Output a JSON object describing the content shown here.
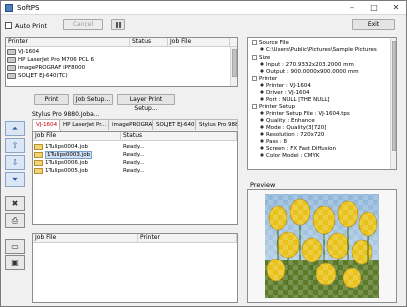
{
  "window": {
    "title": "SoftPS"
  },
  "toolbar": {
    "auto_print_label": "Auto Print",
    "cancel_label": "Cancel",
    "exit_label": "Exit"
  },
  "printers": {
    "headers": [
      "Printer",
      "Status",
      "Job File"
    ],
    "rows": [
      {
        "name": "VJ-1604",
        "status": "",
        "job": ""
      },
      {
        "name": "HP LaserJet Pro M706 PCL 6",
        "status": "",
        "job": ""
      },
      {
        "name": "imagePROGRAF iPF8000",
        "status": "",
        "job": ""
      },
      {
        "name": "SOLJET EJ-640(TC)",
        "status": "",
        "job": ""
      }
    ]
  },
  "actions": {
    "print": "Print",
    "job_setup": "Job Setup...",
    "layer_print_setup": "Layer Print Setup..."
  },
  "queue_title": "Stylus Pro 9880.Joba...",
  "tabs": [
    "VJ-1604",
    "HP LaserJet Pr...",
    "imagePROGRA...",
    "SOLJET EJ-640...",
    "Stylus Pro 9880..."
  ],
  "jobs": {
    "headers": [
      "Job File",
      "Status"
    ],
    "rows": [
      {
        "file": "1Tulips0004.job",
        "status": "Ready..."
      },
      {
        "file": "1Tulips0003.job",
        "status": "Ready..."
      },
      {
        "file": "1Tulips0006.job",
        "status": "Ready..."
      },
      {
        "file": "1Tulips0005.job",
        "status": "Ready..."
      }
    ]
  },
  "history": {
    "headers": [
      "Job File",
      "Printer"
    ]
  },
  "details": {
    "source_file_label": "Source File",
    "source_file_value": "C:\\Users\\Public\\Pictures\\Sample Pictures",
    "size_label": "Size",
    "size_input": "Input : 270.9332x203.2000 mm",
    "size_output": "Output : 900.0000x900.0000 mm",
    "printer_label": "Printer",
    "printer_name": "Printer : VJ-1604",
    "printer_driver": "Driver : VJ-1604",
    "printer_port": "Port : NULL [THE NULL]",
    "setup_label": "Printer Setup",
    "setup_file": "Printer Setup File : VJ-1604.tps",
    "setup_quality": "Quality : Enhance",
    "setup_mode": "Mode : Quality(3[720]",
    "setup_resolution": "Resolution : 720x720",
    "setup_pass": "Pass : 8",
    "setup_screen": "Screen : FX Fast Diffusion",
    "setup_color": "Color Model : CMYK"
  },
  "preview": {
    "label": "Preview"
  },
  "colors": {
    "accent": "#2e5f9e",
    "tab_active_text": "#cc0000",
    "tulip_yellow": "#e8c21a"
  }
}
